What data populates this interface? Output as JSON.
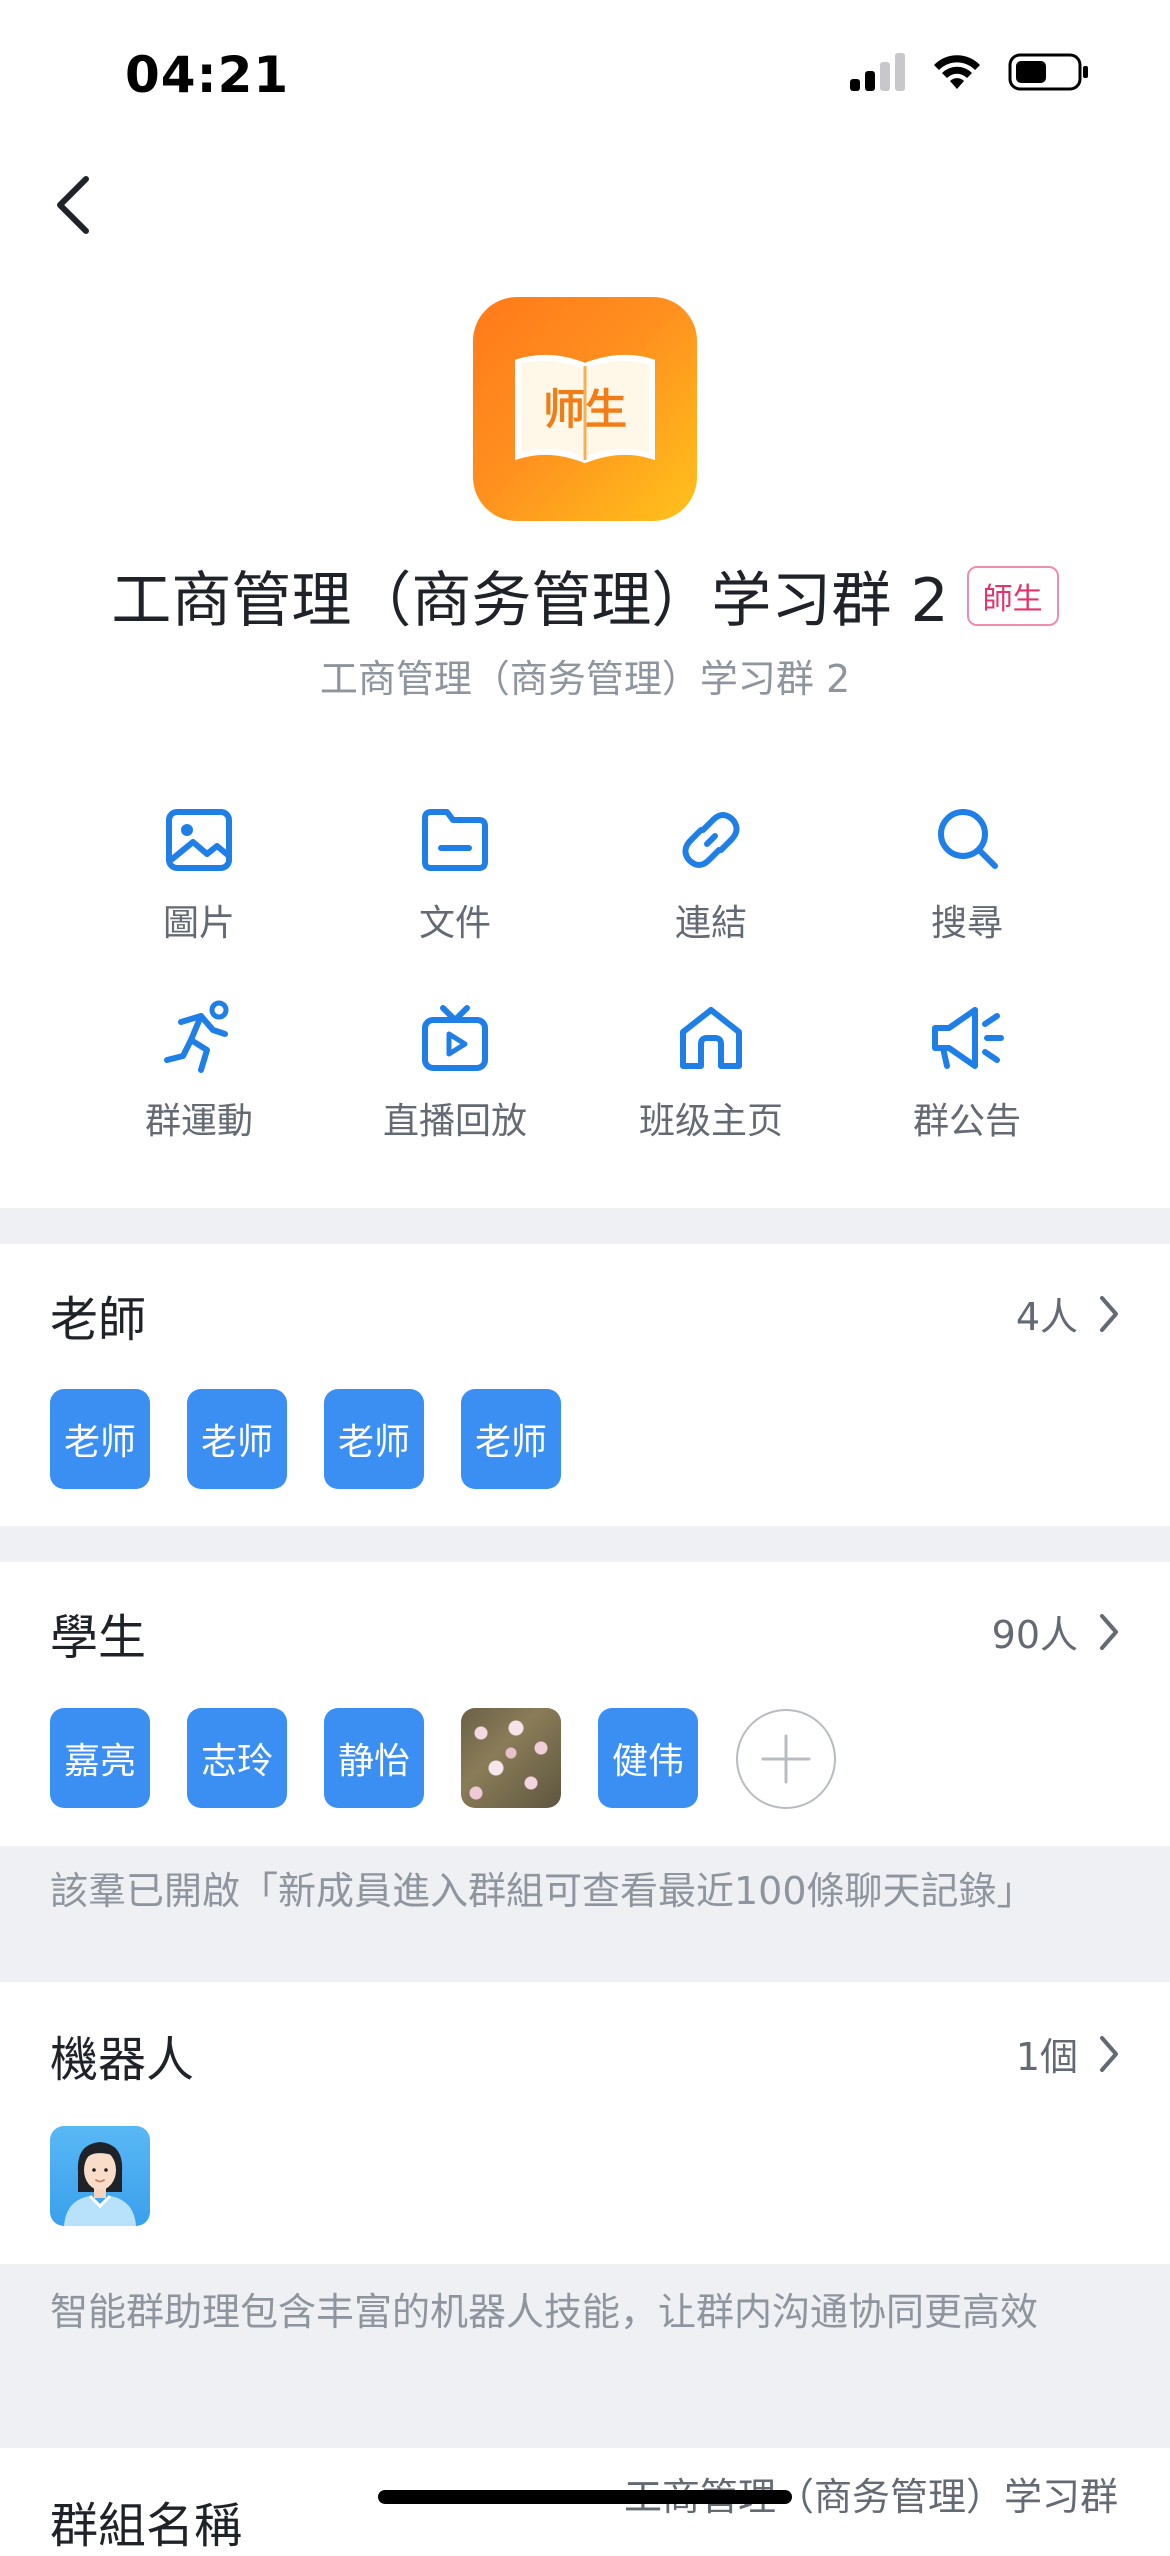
{
  "status_bar": {
    "time": "04:21"
  },
  "header": {
    "avatar_text": "师生",
    "title": "工商管理（商务管理）学习群 2",
    "badge": "師生",
    "subtitle": "工商管理（商务管理）学习群 2"
  },
  "quick_actions": [
    {
      "label": "圖片",
      "icon": "image-icon"
    },
    {
      "label": "文件",
      "icon": "folder-icon"
    },
    {
      "label": "連結",
      "icon": "link-icon"
    },
    {
      "label": "搜尋",
      "icon": "search-icon"
    },
    {
      "label": "群運動",
      "icon": "running-icon"
    },
    {
      "label": "直播回放",
      "icon": "tv-play-icon"
    },
    {
      "label": "班级主页",
      "icon": "home-icon"
    },
    {
      "label": "群公告",
      "icon": "megaphone-icon"
    }
  ],
  "teachers": {
    "title": "老師",
    "count": "4人",
    "members": [
      "老师",
      "老师",
      "老师",
      "老师"
    ]
  },
  "students": {
    "title": "學生",
    "count": "90人",
    "members": [
      "嘉亮",
      "志玲",
      "静怡",
      "",
      "健伟"
    ],
    "notice": "該羣已開啟「新成員進入群組可查看最近100條聊天記錄」"
  },
  "robots": {
    "title": "機器人",
    "count": "1個",
    "notice": "智能群助理包含丰富的机器人技能，让群内沟通协同更高效"
  },
  "group_name": {
    "label": "群組名稱",
    "value": "工商管理（商务管理）学习群"
  },
  "colors": {
    "accent": "#3c8ff2",
    "icon_blue": "#1f7fe6",
    "badge_pink": "#e0356a",
    "divider": "#eef0f3"
  }
}
